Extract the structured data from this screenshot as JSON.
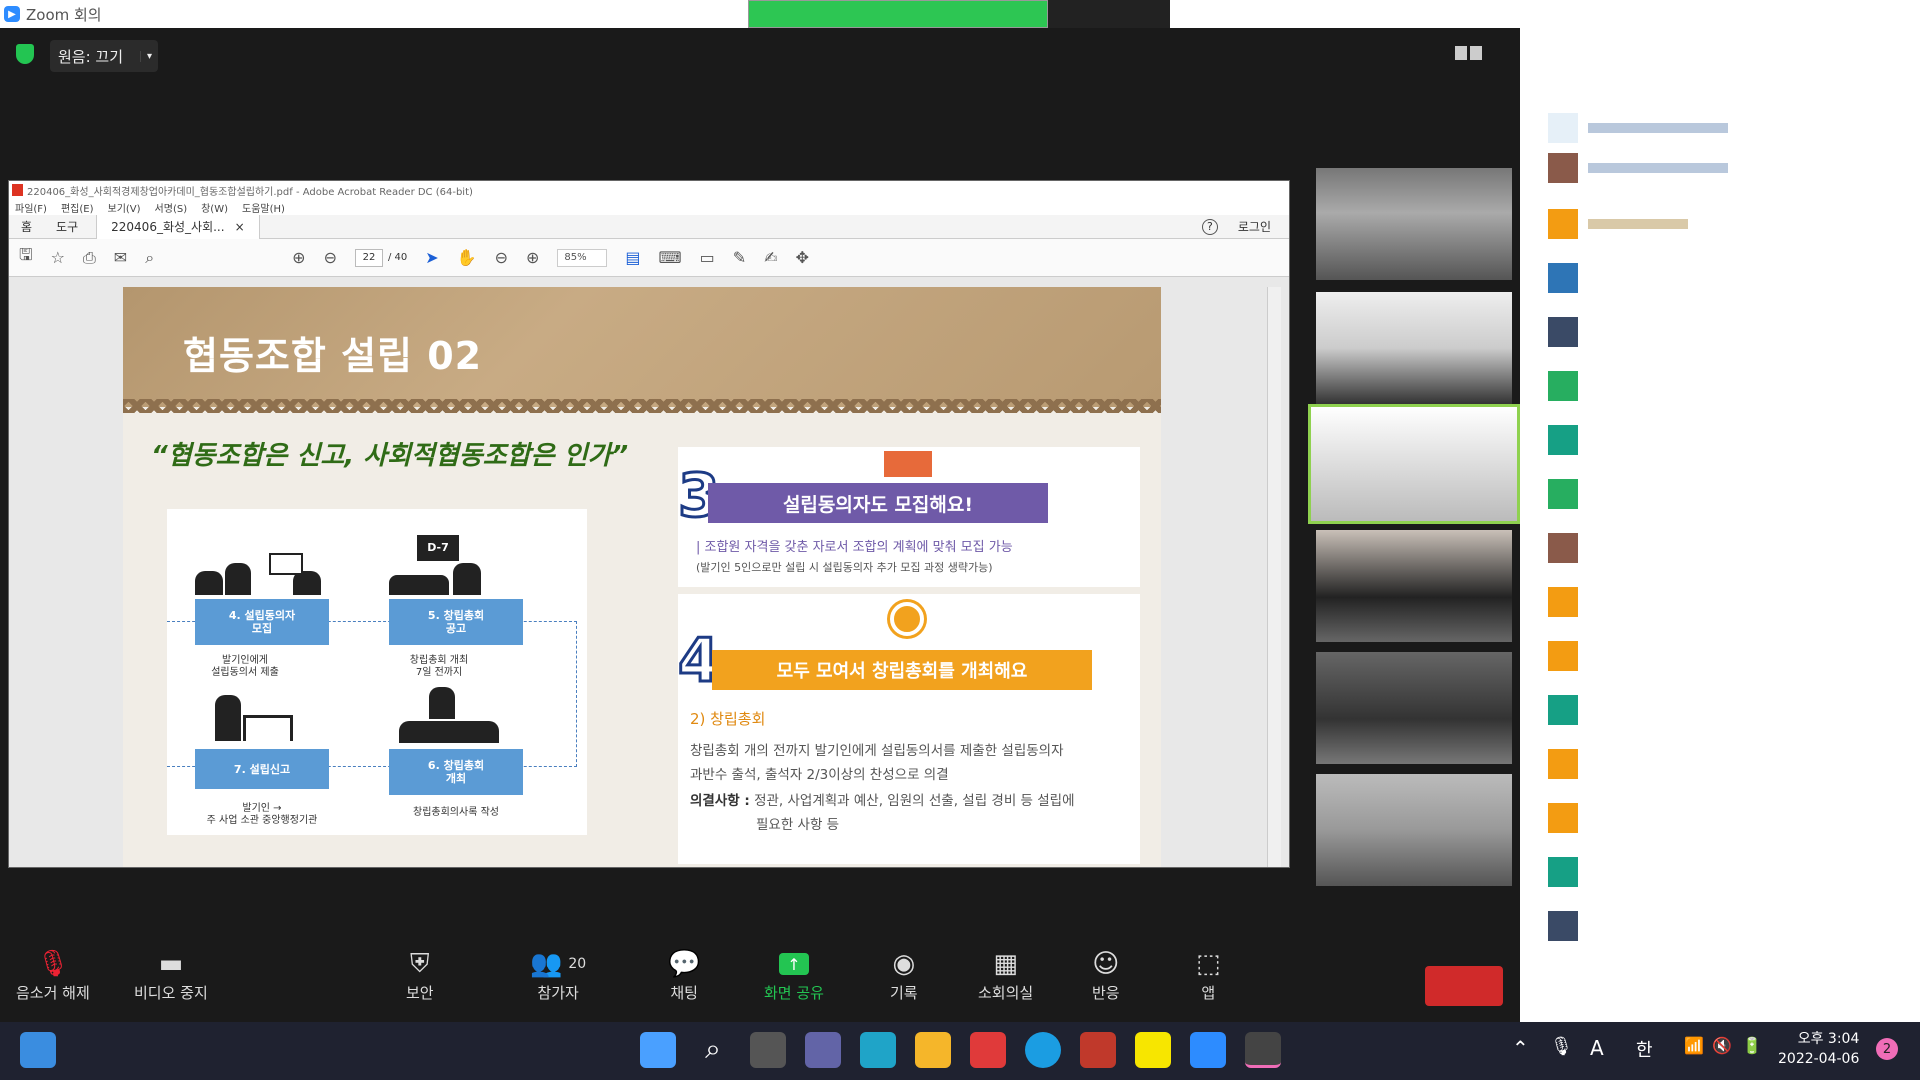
{
  "window": {
    "title": "Zoom 회의",
    "min": "—",
    "max": "❐",
    "close": "✕"
  },
  "meeting": {
    "audio_label": "원음: 끄기",
    "audio_arrow": "▾"
  },
  "acrobat": {
    "title": "220406_화성_사회적경제창업아카데미_협동조합설립하기.pdf - Adobe Acrobat Reader DC (64-bit)",
    "menu": [
      "파일(F)",
      "편집(E)",
      "보기(V)",
      "서명(S)",
      "창(W)",
      "도움말(H)"
    ],
    "tab_home": "홈",
    "tab_tools": "도구",
    "doc_tab": "220406_화성_사회...",
    "doc_tab_close": "×",
    "help": "?",
    "login": "로그인",
    "page_current": "22",
    "page_total": "/ 40",
    "zoom": "85%"
  },
  "slide": {
    "title": "협동조합 설립 02",
    "quote": "“협동조합은 신고, 사회적협동조합은 인가”",
    "flow": {
      "box4": "4. 설립동의자\n모집",
      "note4": "발기인에게\n설립동의서 제출",
      "box5": "5. 창립총회\n공고",
      "note5": "창립총회 개최\n7일 전까지",
      "box7": "7. 설립신고",
      "note7": "발기인 →\n주 사업 소관 중앙행정기관",
      "box6": "6. 창립총회\n개최",
      "note6": "창립총회의사록 작성",
      "d7": "D-7"
    },
    "step3": {
      "num": "3",
      "heading": "설립동의자도 모집해요!",
      "line1": "| 조합원 자격을 갖춘 자로서 조합의 계획에 맞춰 모집 가능",
      "line2": "(발기인 5인으로만 설립 시 설립동의자 추가 모집 과정 생략가능)"
    },
    "step4": {
      "num": "4",
      "heading": "모두 모여서 창립총회를 개최해요",
      "sub": "2) 창립총회",
      "p1": "창립총회 개의 전까지 발기인에게 설립동의서를 제출한 설립동의자",
      "p2": "과반수 출석, 출석자 2/3이상의 찬성으로 의결",
      "p3_label": "의결사항 :",
      "p3": " 정관, 사업계획과 예산, 임원의 선출, 설립 경비 등 설립에",
      "p4": "필요한 사항 등"
    }
  },
  "toolbar": {
    "mute": "음소거 해제",
    "video": "비디오 중지",
    "security": "보안",
    "participants": "참가자",
    "participants_count": "20",
    "chat": "채팅",
    "share": "화면 공유",
    "record": "기록",
    "breakout": "소회의실",
    "reactions": "반응",
    "apps": "앱"
  },
  "taskbar": {
    "time": "오후 3:04",
    "date": "2022-04-06",
    "notifications": "2",
    "ime": "한",
    "font": "A"
  },
  "colors": {
    "zoom_blue": "#2d8cff",
    "share_green": "#23c552",
    "end_red": "#d02a2a",
    "ribbon_purple": "#6f5aa8",
    "ribbon_orange": "#f2a21e",
    "slide_green": "#2f6b16"
  }
}
